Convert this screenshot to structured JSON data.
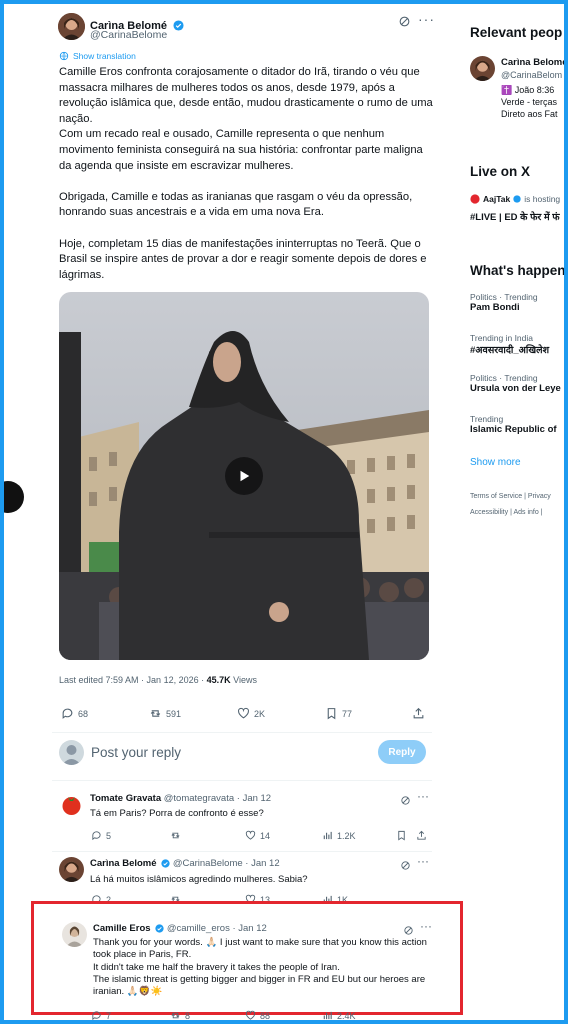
{
  "tweet": {
    "author_name": "Carìna Belomé",
    "author_handle": "@CarinaBelome",
    "show_translation": "Show translation",
    "paragraphs": [
      "Camille Eros confronta corajosamente o ditador do Irã, tirando o véu que massacra milhares de mulheres todos os anos, desde 1979, após a revolução islâmica que, desde então, mudou drasticamente o rumo de uma nação.",
      "Com um recado real e ousado, Camille representa o que nenhum movimento feminista conseguirá na sua história: confrontar parte maligna da agenda que insiste em escravizar mulheres.",
      "Obrigada, Camille e todas as iranianas que rasgam o véu da opressão, honrando suas ancestrais e a vida em uma nova Era.",
      "Hoje, completam 15 dias de manifestações ininterruptas no Teerã. Que o Brasil se inspire antes de provar a dor e reagir somente depois de dores e lágrimas."
    ],
    "meta_prefix": "Last edited 7:59 AM · Jan 12, 2026 ·",
    "views_count": "45.7K",
    "views_label": "Views",
    "replies": "68",
    "reposts": "591",
    "likes": "2K",
    "bookmarks": "77"
  },
  "compose": {
    "placeholder": "Post your reply",
    "button": "Reply"
  },
  "replies": [
    {
      "name": "Tomate Gravata",
      "handle": "@tomategravata",
      "date": "· Jan 12",
      "text": [
        "Tá em Paris? Porra de confronto é esse?"
      ],
      "replies": "5",
      "reposts": "",
      "likes": "14",
      "views": "1.2K",
      "avatar_color": "#e0301e"
    },
    {
      "name": "Carìna Belomé",
      "handle": "@CarinaBelome",
      "date": "· Jan 12",
      "text": [
        "Lá há muitos islâmicos agredindo mulheres. Sabia?"
      ],
      "replies": "2",
      "reposts": "",
      "likes": "13",
      "views": "1K",
      "avatar_color": "#8a5a44"
    },
    {
      "name": "Camille Eros",
      "handle": "@camille_eros",
      "date": "· Jan 12",
      "text": [
        "Thank you for your words. 🙏🏻 I just want to make sure that you know this action took place in Paris, FR.",
        "It didn't take me half the bravery it takes the people of Iran.",
        "The islamic threat is getting bigger and bigger in FR and EU but our heroes are iranian. 🙏🏻🦁☀️"
      ],
      "replies": "7",
      "reposts": "8",
      "likes": "88",
      "views": "2.4K",
      "avatar_color": "#c9c4bd"
    }
  ],
  "sidebar": {
    "relevant_title": "Relevant peop",
    "relevant_name": "Carìna Belomé",
    "relevant_handle": "@CarinaBelom",
    "relevant_bio": [
      "✝️ João 8:36",
      "Verde - terças",
      "Direto aos Fat"
    ],
    "live_title": "Live on X",
    "live_host": "AajTak",
    "live_host_suffix": "is hosting",
    "live_text": "#LIVE | ED के फेर में फं",
    "happening_title": "What's happen",
    "trends": [
      {
        "category": "Politics · Trending",
        "name": "Pam Bondi"
      },
      {
        "category": "Trending in India",
        "name": "#अवसरवादी_अखिलेश"
      },
      {
        "category": "Politics · Trending",
        "name": "Ursula von der Leye"
      },
      {
        "category": "Trending",
        "name": "Islamic Republic of"
      }
    ],
    "show_more": "Show more",
    "footer_row1": [
      "Terms of Service",
      "|",
      "Privacy"
    ],
    "footer_row2": [
      "Accessibility",
      "|",
      "Ads info",
      "|"
    ]
  },
  "colors": {
    "accent": "#1d9bf0",
    "highlight_box": "#e3262e",
    "page_border": "#1d9bf0"
  }
}
